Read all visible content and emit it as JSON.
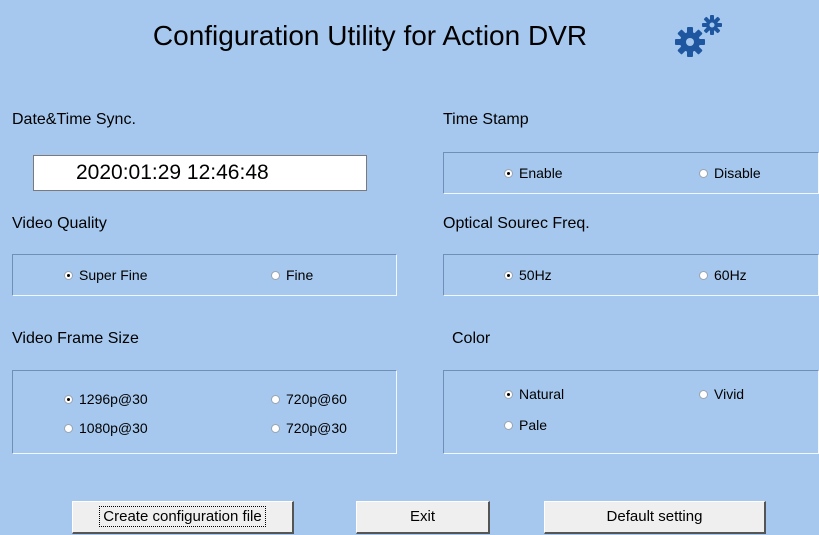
{
  "app": {
    "title": "Configuration Utility for Action DVR"
  },
  "icons": {
    "settings": "gear-icon",
    "color": "#1e56a0"
  },
  "datetime": {
    "label": "Date&Time Sync.",
    "value": "2020:01:29  12:46:48"
  },
  "time_stamp": {
    "label": "Time Stamp",
    "options": [
      "Enable",
      "Disable"
    ],
    "selected": "Enable"
  },
  "video_quality": {
    "label": "Video Quality",
    "options": [
      "Super Fine",
      "Fine"
    ],
    "selected": "Super Fine"
  },
  "optical_freq": {
    "label": "Optical Sourec Freq.",
    "options": [
      "50Hz",
      "60Hz"
    ],
    "selected": "50Hz"
  },
  "frame_size": {
    "label": "Video Frame Size",
    "options": [
      "1296p@30",
      "720p@60",
      "1080p@30",
      "720p@30"
    ],
    "selected": "1296p@30"
  },
  "color": {
    "label": "Color",
    "options": [
      "Natural",
      "Vivid",
      "Pale"
    ],
    "selected": "Natural"
  },
  "buttons": {
    "create": "Create configuration file",
    "exit": "Exit",
    "default": "Default setting"
  }
}
